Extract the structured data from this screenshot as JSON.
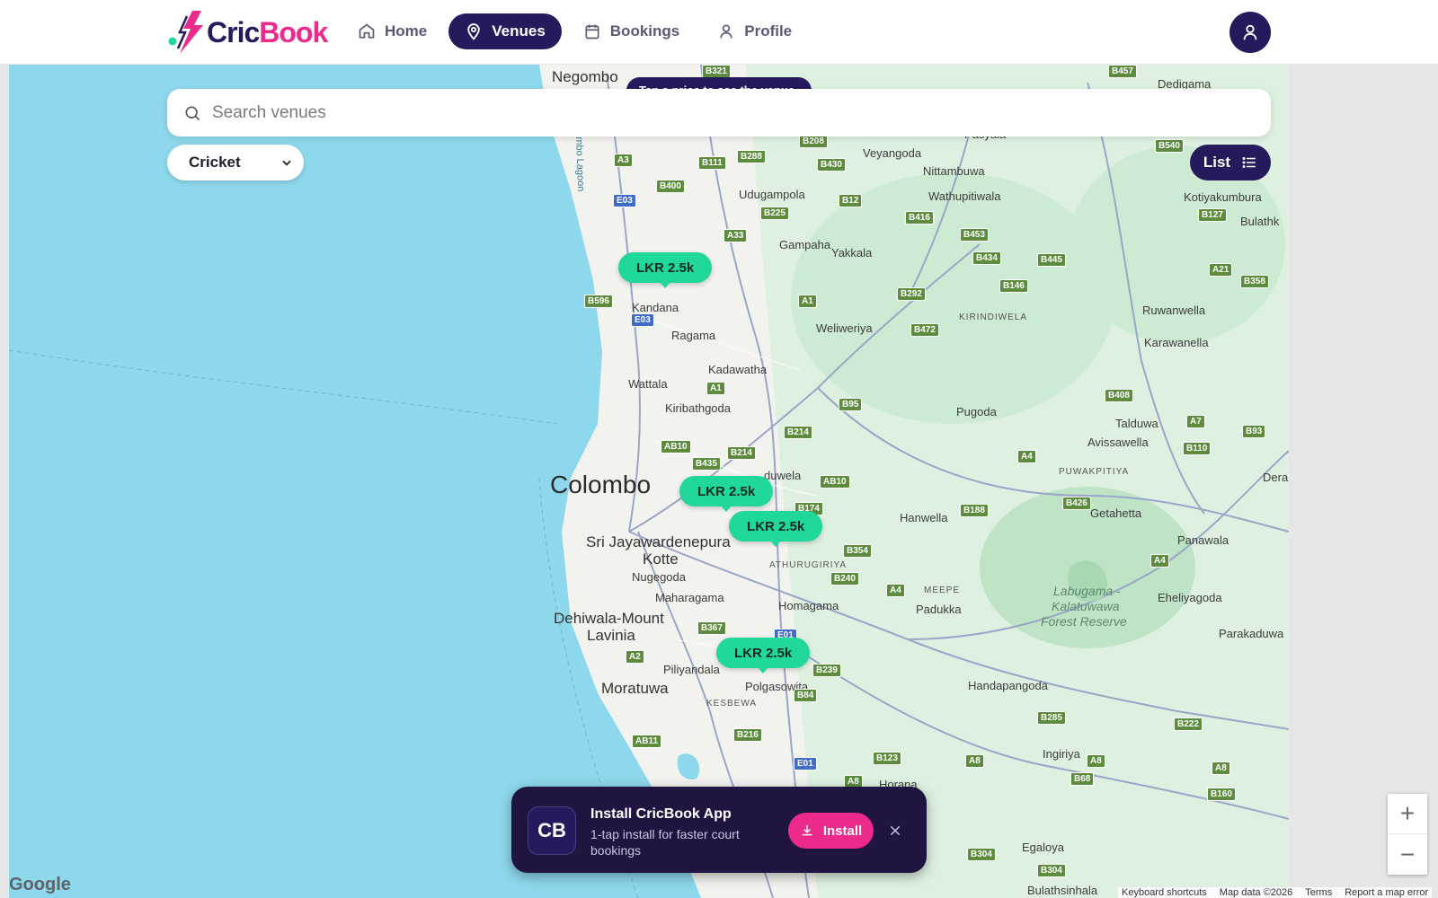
{
  "header": {
    "logo_part1": "Cric",
    "logo_part2": "Book",
    "nav": [
      {
        "label": "Home",
        "icon": "home-icon",
        "active": false
      },
      {
        "label": "Venues",
        "icon": "map-pin-icon",
        "active": true
      },
      {
        "label": "Bookings",
        "icon": "calendar-icon",
        "active": false
      },
      {
        "label": "Profile",
        "icon": "user-icon",
        "active": false
      }
    ],
    "avatar_icon": "user-icon"
  },
  "search": {
    "placeholder": "Search venues",
    "value": ""
  },
  "filter": {
    "sport_selected": "Cricket"
  },
  "list_button": {
    "label": "List"
  },
  "hint": {
    "text": "Tap a price to see the venue"
  },
  "map": {
    "price_markers": [
      "LKR 2.5k",
      "LKR 2.5k",
      "LKR 2.5k",
      "LKR 2.5k"
    ],
    "places": {
      "negombo": "Negombo",
      "colombo": "Colombo",
      "sjk1": "Sri Jayawardenepura",
      "sjk2": "Kotte",
      "dml1": "Dehiwala-Mount",
      "dml2": "Lavinia",
      "moratuwa": "Moratuwa",
      "veyangoda": "Veyangoda",
      "nittambuwa": "Nittambuwa",
      "udugampola": "Udugampola",
      "wathupitiwala": "Wathupitiwala",
      "gampaha": "Gampaha",
      "yakkala": "Yakkala",
      "kandana": "Kandana",
      "ragama": "Ragama",
      "weliweriya": "Weliweriya",
      "kadawatha": "Kadawatha",
      "wattala": "Wattala",
      "kiribathgoda": "Kiribathgoda",
      "pugoda": "Pugoda",
      "hanwella": "Hanwella",
      "nugegoda": "Nugegoda",
      "maharagama": "Maharagama",
      "homagama": "Homagama",
      "padukka": "Padukka",
      "piliyandala": "Piliyandala",
      "polgasowita": "Polgasowita",
      "handapangoda": "Handapangoda",
      "ingiriya": "Ingiriya",
      "horana": "Horana",
      "egaloya": "Egaloya",
      "bulathsinhala": "Bulathsinhala",
      "kotiyakumbura": "Kotiyakumbura",
      "ruwanwella": "Ruwanwella",
      "karawanella": "Karawanella",
      "talduwa": "Talduwa",
      "avissawella": "Avissawella",
      "getahetta": "Getahetta",
      "panawala": "Panawala",
      "eheliyagoda": "Eheliyagoda",
      "parakaduwa": "Parakaduwa",
      "dedigama": "Dedigama",
      "pasyala": "Pasyala",
      "kirindiwela": "KIRINDIWELA",
      "puwakpitiya": "PUWAKPITIYA",
      "athurugiriya": "ATHURUGIRIYA",
      "meepe": "MEEPE",
      "kesbewa": "KESBEWA",
      "reserve1": "Labugama -",
      "reserve2": "Kalatuwawa",
      "reserve3": "Forest Reserve",
      "lagoon": "mbo Lagoon",
      "bulathk": "Bulathk",
      "dera": "Dera",
      "duwela": "duwela"
    },
    "roads": [
      "B321",
      "B457",
      "B208",
      "B540",
      "A3",
      "B288",
      "B111",
      "B430",
      "B400",
      "B12",
      "E03",
      "B225",
      "B416",
      "B127",
      "A33",
      "B453",
      "B434",
      "B445",
      "B596",
      "B146",
      "B292",
      "A21",
      "B358",
      "A1",
      "E03",
      "B472",
      "A1",
      "B95",
      "B408",
      "A7",
      "B93",
      "B214",
      "AB10",
      "B110",
      "B214",
      "B435",
      "A4",
      "AB10",
      "B174",
      "B188",
      "B426",
      "B354",
      "B240",
      "A4",
      "A4",
      "B367",
      "E01",
      "A2",
      "B239",
      "B84",
      "B285",
      "B222",
      "B216",
      "AB11",
      "B123",
      "E01",
      "A8",
      "A8",
      "A8",
      "B68",
      "B160",
      "A8",
      "B304",
      "B304"
    ]
  },
  "install_banner": {
    "logo_text": "CB",
    "title": "Install CricBook App",
    "subtitle": "1-tap install for faster court bookings",
    "button": "Install"
  },
  "map_controls": {
    "zoom_in": "+",
    "zoom_out": "−"
  },
  "attribution": {
    "google": "Google",
    "keyboard": "Keyboard shortcuts",
    "mapdata": "Map data ©2026",
    "terms": "Terms",
    "report": "Report a map error"
  },
  "colors": {
    "brand_navy": "#241a5c",
    "brand_pink": "#ec2a8c",
    "price_green": "#20d89a",
    "sea": "#8dd8ec"
  }
}
